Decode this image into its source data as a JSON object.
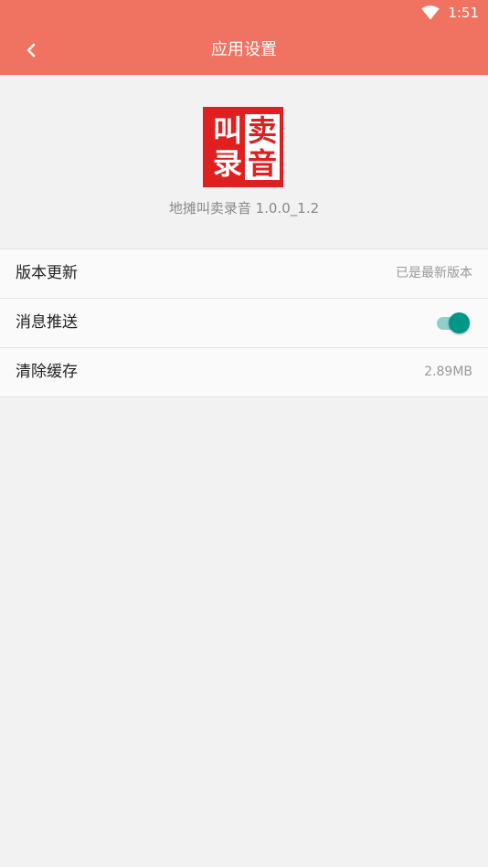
{
  "status_bar": {
    "time": "1:51",
    "wifi_icon": "wifi-icon"
  },
  "app_bar": {
    "back_icon": "chevron-left-icon",
    "title": "应用设置",
    "background_color": "#f07260"
  },
  "app_info": {
    "logo_text": [
      "叫",
      "卖",
      "录",
      "音"
    ],
    "logo_color": "#e02020",
    "version_text": "地摊叫卖录音 1.0.0_1.2"
  },
  "settings": {
    "version_update": {
      "label": "版本更新",
      "value": "已是最新版本"
    },
    "push_notifications": {
      "label": "消息推送",
      "enabled": true,
      "accent_color": "#009688"
    },
    "clear_cache": {
      "label": "清除缓存",
      "value": "2.89MB"
    }
  }
}
